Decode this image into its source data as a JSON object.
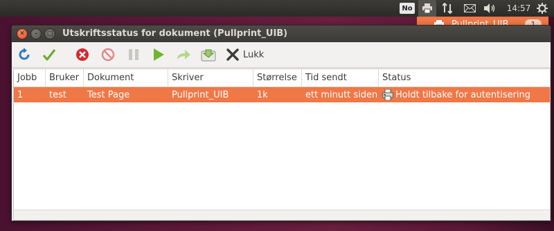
{
  "top_panel": {
    "keyboard_indicator": "No",
    "clock": "14:57",
    "icons": [
      "printer-icon",
      "network-arrows-icon",
      "mail-icon",
      "volume-icon",
      "gear-icon"
    ]
  },
  "notification": {
    "label": "Pullprint_UIB",
    "count": "1"
  },
  "window": {
    "title": "Utskriftsstatus for dokument (Pullprint_UIB)"
  },
  "toolbar": {
    "close_label": "Lukk",
    "icons": [
      "refresh-icon",
      "check-icon",
      "cancel-icon",
      "stop-icon",
      "pause-icon",
      "play-icon",
      "redirect-icon",
      "save-icon",
      "close-x-icon"
    ]
  },
  "table": {
    "columns": [
      "Jobb",
      "Bruker",
      "Dokument",
      "Skriver",
      "Størrelse",
      "Tid sendt",
      "Status"
    ],
    "rows": [
      {
        "job": "1",
        "user": "test",
        "document": "Test Page",
        "printer": "Pullprint_UIB",
        "size": "1k",
        "time_sent": "ett minutt siden",
        "status": "Holdt tilbake for autentisering"
      }
    ]
  },
  "colors": {
    "accent": "#f07746",
    "titlebar": "#3b3a36",
    "panel": "#2c2b28"
  }
}
